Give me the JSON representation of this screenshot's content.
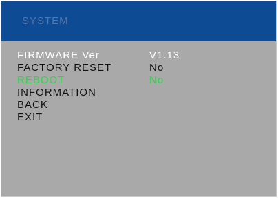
{
  "title": "SYSTEM",
  "colors": {
    "title_bar": "#0d4b94",
    "title_text": "#5576a6",
    "panel": "#a9a9a9",
    "item_normal": "#111111",
    "item_info": "#ffffff",
    "item_selected": "#2fd34a"
  },
  "menu": {
    "firmware": {
      "label": "FIRMWARE Ver",
      "value": "V1.13"
    },
    "factory_reset": {
      "label": "FACTORY RESET",
      "value": "No"
    },
    "reboot": {
      "label": "REBOOT",
      "value": "No",
      "selected": true
    },
    "information": {
      "label": "INFORMATION"
    },
    "back": {
      "label": "BACK"
    },
    "exit": {
      "label": "EXIT"
    }
  }
}
